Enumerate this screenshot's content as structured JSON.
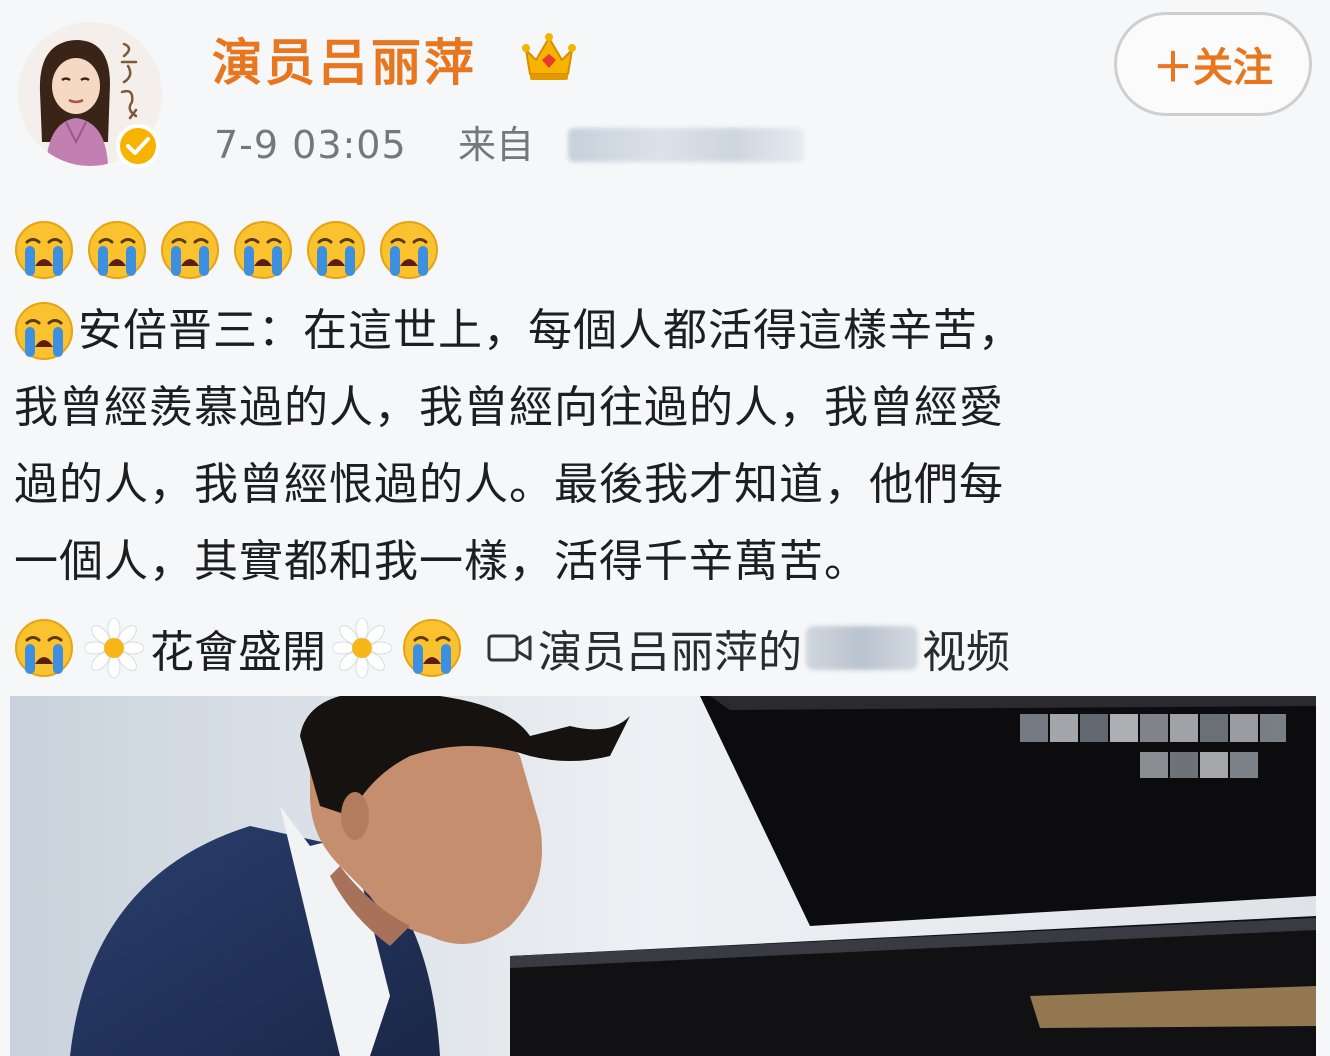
{
  "post": {
    "username": "演员吕丽萍",
    "time": "7-9 03:05",
    "source_label": "来自",
    "follow_label": "＋关注",
    "text_lines": [
      "安倍晋三：在這世上，每個人都活得這樣辛苦，",
      "我曾經羨慕過的人，我曾經向往過的人，我曾經愛",
      "過的人，我曾經恨過的人。最後我才知道，他們每",
      "一個人，其實都和我一樣，活得千辛萬苦。"
    ],
    "flower_text": "花會盛開",
    "video_prefix": "演员吕丽萍的",
    "video_suffix": "视频"
  },
  "colors": {
    "username": "#e8761e",
    "meta": "#777777",
    "background": "#f6f7f9"
  },
  "icons": [
    "crown-icon",
    "verified-icon",
    "crying-emoji",
    "daisy-emoji",
    "video-icon"
  ]
}
